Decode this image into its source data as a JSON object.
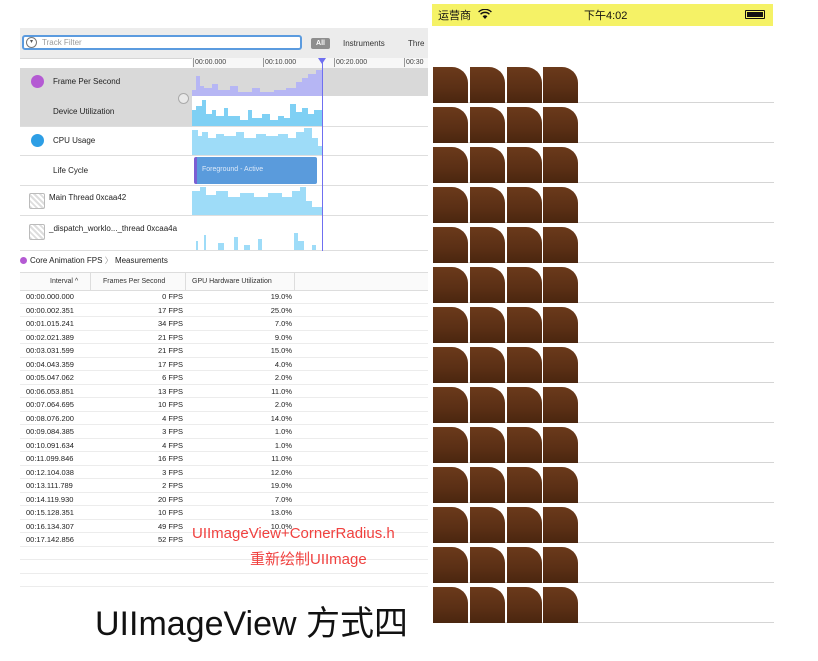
{
  "instruments": {
    "filter_placeholder": "Track Filter",
    "filter_all": "All",
    "filter_instruments": "Instruments",
    "filter_threads": "Thre",
    "ruler_ticks": [
      "00:00.000",
      "00:10.000",
      "00:20.000",
      "00:30"
    ],
    "tracks": [
      {
        "name": "Frame Per Second",
        "icon": "fps-instrument-icon"
      },
      {
        "name": "Device Utilization",
        "icon": ""
      },
      {
        "name": "CPU Usage",
        "icon": "cpu-usage-icon"
      },
      {
        "name": "Life Cycle",
        "icon": ""
      },
      {
        "name": "Main Thread  0xcaa42",
        "icon": "thread-icon"
      },
      {
        "name": "_dispatch_worklo..._thread  0xcaa4a",
        "icon": "thread-icon"
      }
    ],
    "lifecycle_label": "Foreground - Active",
    "breadcrumb": {
      "instrument": "Core Animation FPS",
      "view": "Measurements"
    },
    "columns": {
      "interval": "Interval ^",
      "fps": "Frames Per Second",
      "gpu": "GPU Hardware Utilization"
    },
    "rows": [
      {
        "interval": "00:00.000.000",
        "fps": "0 FPS",
        "gpu": "19.0%"
      },
      {
        "interval": "00:00.002.351",
        "fps": "17 FPS",
        "gpu": "25.0%"
      },
      {
        "interval": "00:01.015.241",
        "fps": "34 FPS",
        "gpu": "7.0%"
      },
      {
        "interval": "00:02.021.389",
        "fps": "21 FPS",
        "gpu": "9.0%"
      },
      {
        "interval": "00:03.031.599",
        "fps": "21 FPS",
        "gpu": "15.0%"
      },
      {
        "interval": "00:04.043.359",
        "fps": "17 FPS",
        "gpu": "4.0%"
      },
      {
        "interval": "00:05.047.062",
        "fps": "6 FPS",
        "gpu": "2.0%"
      },
      {
        "interval": "00:06.053.851",
        "fps": "13 FPS",
        "gpu": "11.0%"
      },
      {
        "interval": "00:07.064.695",
        "fps": "10 FPS",
        "gpu": "2.0%"
      },
      {
        "interval": "00:08.076.200",
        "fps": "4 FPS",
        "gpu": "14.0%"
      },
      {
        "interval": "00:09.084.385",
        "fps": "3 FPS",
        "gpu": "1.0%"
      },
      {
        "interval": "00:10.091.634",
        "fps": "4 FPS",
        "gpu": "1.0%"
      },
      {
        "interval": "00:11.099.846",
        "fps": "16 FPS",
        "gpu": "11.0%"
      },
      {
        "interval": "00:12.104.038",
        "fps": "3 FPS",
        "gpu": "12.0%"
      },
      {
        "interval": "00:13.111.789",
        "fps": "2 FPS",
        "gpu": "19.0%"
      },
      {
        "interval": "00:14.119.930",
        "fps": "20 FPS",
        "gpu": "7.0%"
      },
      {
        "interval": "00:15.128.351",
        "fps": "10 FPS",
        "gpu": "13.0%"
      },
      {
        "interval": "00:16.134.307",
        "fps": "49 FPS",
        "gpu": "10.0%"
      },
      {
        "interval": "00:17.142.856",
        "fps": "52 FPS",
        "gpu": ""
      }
    ]
  },
  "annotation": {
    "line1": "UIImageView+CornerRadius.h",
    "line2": "重新绘制UIImage",
    "caption": "UIImageView 方式四"
  },
  "phone": {
    "carrier": "运营商",
    "time": "下午4:02",
    "cell_count": 14,
    "images_per_cell": 4
  },
  "colors": {
    "accent": "#5b9bdf",
    "annotation": "#f0413f",
    "statusbar": "#f5f266",
    "image": "#5a2f15"
  }
}
